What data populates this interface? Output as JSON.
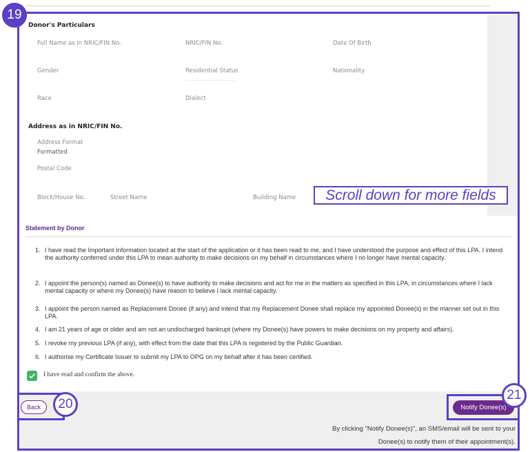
{
  "callouts": {
    "c19": "19",
    "c20": "20",
    "c21": "21"
  },
  "particulars": {
    "title": "Donor's Particulars",
    "labels": {
      "full_name": "Full Name as in NRIC/FIN No.",
      "nric": "NRIC/FIN No.",
      "dob": "Date Of Birth",
      "gender": "Gender",
      "residential_status": "Residential Status",
      "nationality": "Nationality",
      "race": "Race",
      "dialect": "Dialect"
    },
    "address_title": "Address as in NRIC/FIN No.",
    "address_format_label": "Address Format",
    "address_format_value": "Formatted",
    "postal_code_label": "Postal Code",
    "block_label": "Block/House No.",
    "street_label": "Street Name",
    "building_label": "Building Name"
  },
  "scroll_hint": "Scroll down for more fields",
  "statement": {
    "title": "Statement by Donor",
    "items": [
      {
        "n": "1.",
        "text": "I have read the Important Information located at the start of the application or it has been read to me, and I have understood the purpose and effect of this LPA. I intend the authority conferred under this LPA to mean authority to make decisions on my behalf in circumstances where I no longer have mental capacity."
      },
      {
        "n": "2.",
        "text": "I appoint the person(s) named as Donee(s) to have authority to make decisions and act for me in the matters as specified in this LPA, in circumstances where I lack mental capacity or where my Donee(s) have reason to believe I lack mental capacity."
      },
      {
        "n": "3.",
        "text": "I appoint the person named as Replacement Donee (if any) and intend that my Replacement Donee shall replace my appointed Donee(s) in the manner set out in this LPA."
      },
      {
        "n": "4.",
        "text": "I am 21 years of age or older and am not an undischarged bankrupt (where my Donee(s) have powers to make decisions on my property and affairs)."
      },
      {
        "n": "5.",
        "text": "I revoke my previous LPA (if any), with effect from the date that this LPA is registered by the Public Guardian."
      },
      {
        "n": "6.",
        "text": "I authorise my Certificate Issuer to submit my LPA to OPG on my behalf after it has been certified."
      }
    ],
    "confirm_label": "I have read and confirm the above.",
    "confirm_checked": true
  },
  "footer": {
    "back_label": "Back",
    "notify_label": "Notify Donee(s)",
    "note_line1": "By clicking \"Notify Donee(s)\", an SMS/email will be sent to your",
    "note_line2": "Donee(s) to notify them of their appointment(s)."
  },
  "colors": {
    "annotation": "#5b3fc4",
    "primary": "#6d2a8a",
    "check": "#3eb46a"
  }
}
